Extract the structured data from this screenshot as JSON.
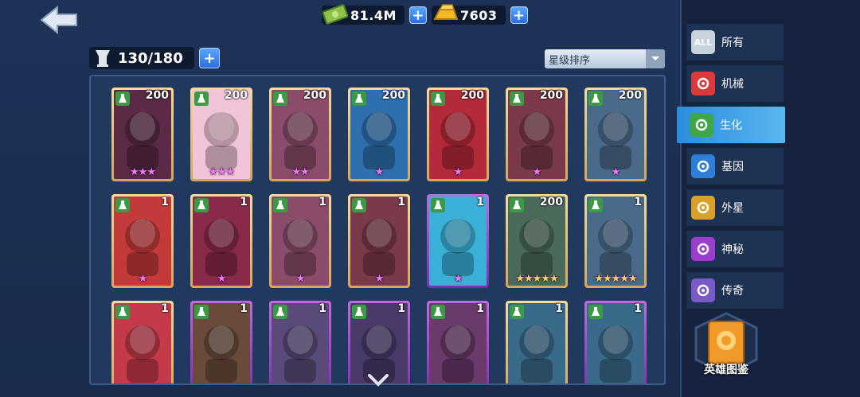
{
  "header": {
    "money": "81.4M",
    "gold": "7603",
    "plus": "+"
  },
  "capacity": {
    "value": "130/180",
    "plus": "+"
  },
  "sort": {
    "selected": "星级排序"
  },
  "sidebar": {
    "tabs": [
      {
        "label": "所有",
        "icon": "all-icon",
        "badge": "ALL",
        "color": "#c9d3de"
      },
      {
        "label": "机械",
        "icon": "mech-icon",
        "color": "#d93b3b"
      },
      {
        "label": "生化",
        "icon": "biochem-icon",
        "color": "#3fa64a",
        "active": true
      },
      {
        "label": "基因",
        "icon": "dna-icon",
        "color": "#2e7fd8"
      },
      {
        "label": "外星",
        "icon": "alien-icon",
        "color": "#d9a12a"
      },
      {
        "label": "神秘",
        "icon": "mystery-icon",
        "color": "#9a3ed0"
      },
      {
        "label": "传奇",
        "icon": "legend-icon",
        "color": "#7a5ac8"
      }
    ],
    "codex_label": "英雄图鉴"
  },
  "cards": [
    {
      "level": "200",
      "stars": "★★★",
      "star_color": "pink",
      "frame": "green",
      "bg": "#5a2a46"
    },
    {
      "level": "200",
      "stars": "★★★",
      "star_color": "pink",
      "frame": "green",
      "bg": "#f2c4d8"
    },
    {
      "level": "200",
      "stars": "★★",
      "star_color": "pink",
      "frame": "green",
      "bg": "#8a4c6a"
    },
    {
      "level": "200",
      "stars": "★",
      "star_color": "pink",
      "frame": "green",
      "bg": "#2e6fae"
    },
    {
      "level": "200",
      "stars": "★",
      "star_color": "pink",
      "frame": "green",
      "bg": "#b42a3a"
    },
    {
      "level": "200",
      "stars": "★",
      "star_color": "pink",
      "frame": "green",
      "bg": "#7a3a4a"
    },
    {
      "level": "200",
      "stars": "★",
      "star_color": "pink",
      "frame": "green",
      "bg": "#4a6a8a"
    },
    {
      "level": "1",
      "stars": "★",
      "star_color": "pink",
      "frame": "green",
      "bg": "#c43a3a"
    },
    {
      "level": "1",
      "stars": "★",
      "star_color": "pink",
      "frame": "green",
      "bg": "#8a2a4a"
    },
    {
      "level": "1",
      "stars": "★",
      "star_color": "pink",
      "frame": "green",
      "bg": "#8a4c6a"
    },
    {
      "level": "1",
      "stars": "★",
      "star_color": "pink",
      "frame": "green",
      "bg": "#7a3a4a"
    },
    {
      "level": "1",
      "stars": "★",
      "star_color": "pink",
      "frame": "purple",
      "bg": "#3ab0d8"
    },
    {
      "level": "200",
      "stars": "★★★★★",
      "star_color": "gold",
      "frame": "green",
      "bg": "#4a6a5a"
    },
    {
      "level": "1",
      "stars": "★★★★★",
      "star_color": "gold",
      "frame": "green",
      "bg": "#4a6a8a"
    },
    {
      "level": "1",
      "stars": "",
      "star_color": "pink",
      "frame": "green",
      "bg": "#c43a4a"
    },
    {
      "level": "1",
      "stars": "",
      "star_color": "pink",
      "frame": "purple",
      "bg": "#6a4a3a"
    },
    {
      "level": "1",
      "stars": "",
      "star_color": "pink",
      "frame": "purple",
      "bg": "#5a4a7a"
    },
    {
      "level": "1",
      "stars": "",
      "star_color": "pink",
      "frame": "purple",
      "bg": "#4a3a6a"
    },
    {
      "level": "1",
      "stars": "",
      "star_color": "pink",
      "frame": "purple",
      "bg": "#6a3a6a"
    },
    {
      "level": "1",
      "stars": "",
      "star_color": "pink",
      "frame": "green",
      "bg": "#3a6a8a"
    },
    {
      "level": "1",
      "stars": "",
      "star_color": "pink",
      "frame": "purple",
      "bg": "#3a6a8a"
    }
  ]
}
